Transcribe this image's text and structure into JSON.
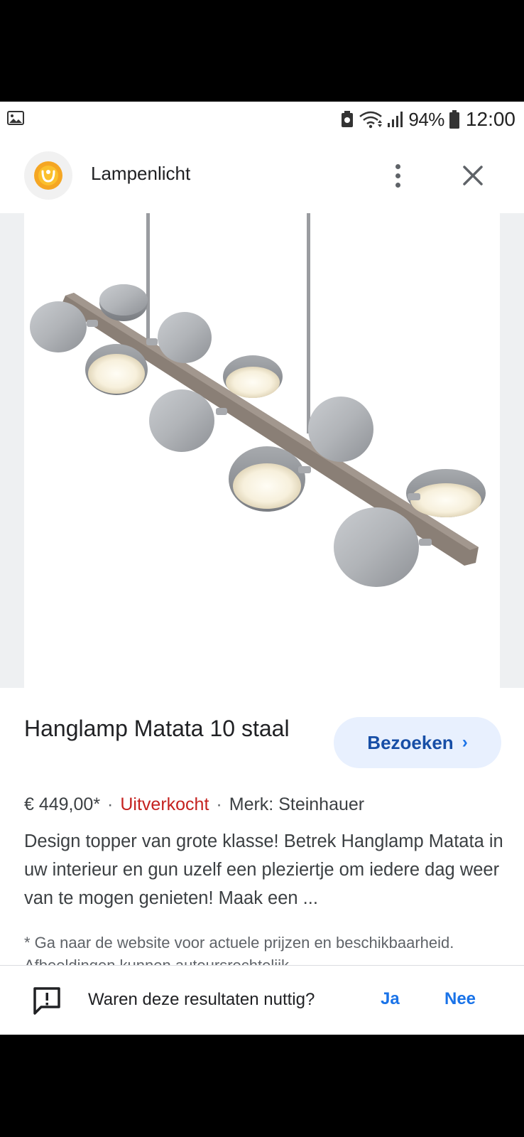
{
  "status_bar": {
    "battery_percent": "94%",
    "time": "12:00",
    "icons": [
      "image-icon",
      "nfc-icon",
      "wifi-icon",
      "signal-icon",
      "battery-icon"
    ]
  },
  "header": {
    "site_name": "Lampenlicht",
    "logo_icon": "lampenlicht-logo",
    "more_icon": "more-vert-icon",
    "close_icon": "close-icon"
  },
  "product": {
    "title": "Hanglamp Matata 10 staal",
    "visit_label": "Bezoeken",
    "price": "€ 449,00*",
    "availability": "Uitverkocht",
    "brand": "Merk: Steinhauer",
    "description": "Design topper van grote klasse! Betrek Hanglamp Matata in uw interieur en gun uzelf een pleziertje om iedere dag weer van te mogen genieten! Maak een ...",
    "disclaimer": "* Ga naar de website voor actuele prijzen en beschikbaarheid. Afbeeldingen kunnen auteursrechtelijk"
  },
  "feedback": {
    "question": "Waren deze resultaten nuttig?",
    "yes": "Ja",
    "no": "Nee"
  },
  "colors": {
    "accent": "#1a73e8",
    "soldout": "#c5221f",
    "button_bg": "#e8f0fe"
  }
}
